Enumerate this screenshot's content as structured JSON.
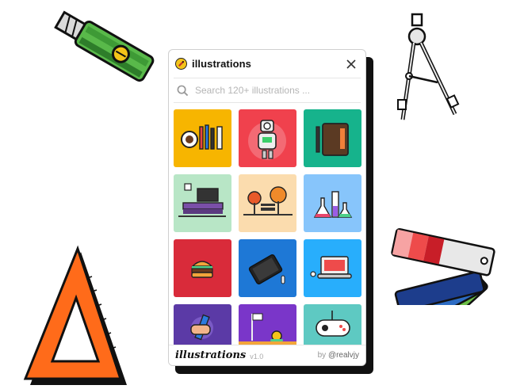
{
  "header": {
    "title": "illustrations"
  },
  "search": {
    "placeholder": "Search 120+ illustrations ..."
  },
  "tiles": [
    {
      "icon": "coffee-pens-illustration",
      "color": "#f7b500"
    },
    {
      "icon": "robot-illustration",
      "color": "#f0414d"
    },
    {
      "icon": "notebook-illustration",
      "color": "#16b38c"
    },
    {
      "icon": "tv-room-illustration",
      "color": "#b8e6c6"
    },
    {
      "icon": "park-bench-illustration",
      "color": "#fbdcae"
    },
    {
      "icon": "lab-flasks-illustration",
      "color": "#87c5fb"
    },
    {
      "icon": "burger-illustration",
      "color": "#d92b3a"
    },
    {
      "icon": "tablet-stylus-illustration",
      "color": "#1e78d6"
    },
    {
      "icon": "laptop-mouse-illustration",
      "color": "#28aefc"
    },
    {
      "icon": "pen-hand-illustration",
      "color": "#5b3aa6"
    },
    {
      "icon": "snail-finish-illustration",
      "color": "#7a36c9"
    },
    {
      "icon": "gamepad-illustration",
      "color": "#5ec9c2"
    }
  ],
  "footer": {
    "brand": "illustrations",
    "version": "v1.0",
    "by": "by",
    "author": "@realvjy"
  }
}
